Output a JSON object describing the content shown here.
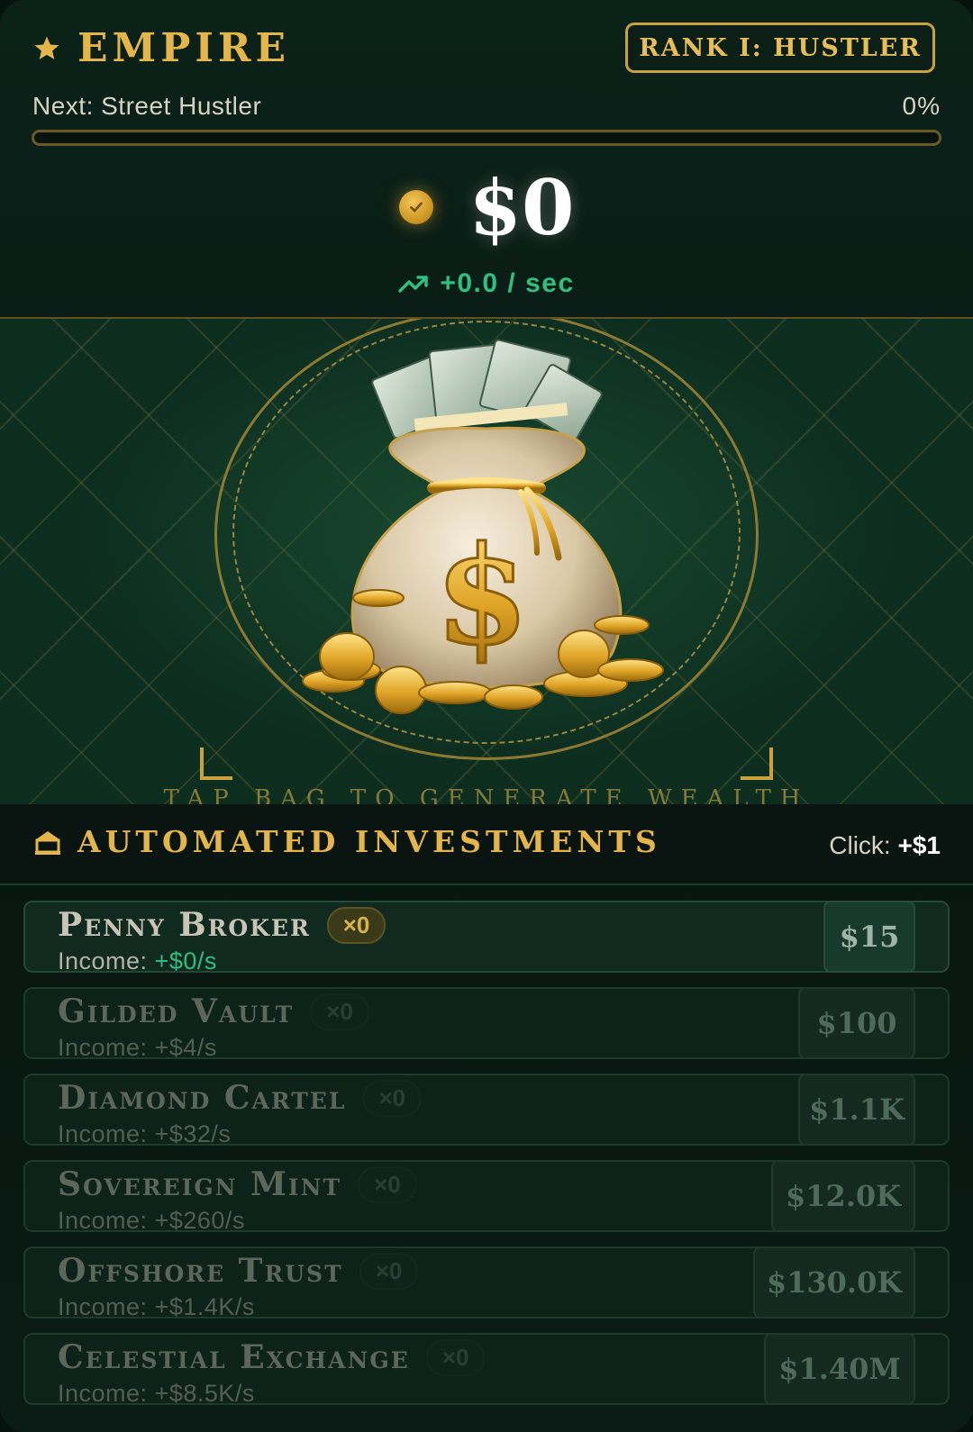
{
  "header": {
    "title": "EMPIRE",
    "rank_badge": "RANK I: HUSTLER",
    "next_label": "Next: Street Hustler",
    "progress_percent": "0%",
    "progress_value": 0
  },
  "balance": {
    "amount": "$0",
    "rate": "+0.0 / sec"
  },
  "stage": {
    "hint": "TAP BAG TO GENERATE WEALTH"
  },
  "investments": {
    "title": "AUTOMATED INVESTMENTS",
    "click_label": "Click:",
    "click_value": "+$1",
    "income_label": "Income:",
    "items": [
      {
        "name": "Penny Broker",
        "count": "×0",
        "income": "+$0/s",
        "cost": "$15"
      },
      {
        "name": "Gilded Vault",
        "count": "×0",
        "income": "+$4/s",
        "cost": "$100"
      },
      {
        "name": "Diamond Cartel",
        "count": "×0",
        "income": "+$32/s",
        "cost": "$1.1K"
      },
      {
        "name": "Sovereign Mint",
        "count": "×0",
        "income": "+$260/s",
        "cost": "$12.0K"
      },
      {
        "name": "Offshore Trust",
        "count": "×0",
        "income": "+$1.4K/s",
        "cost": "$130.0K"
      },
      {
        "name": "Celestial Exchange",
        "count": "×0",
        "income": "+$8.5K/s",
        "cost": "$1.40M"
      }
    ]
  },
  "colors": {
    "gold": "#e3b54a",
    "green_rate": "#2fbf80",
    "background": "#0a1d16"
  }
}
